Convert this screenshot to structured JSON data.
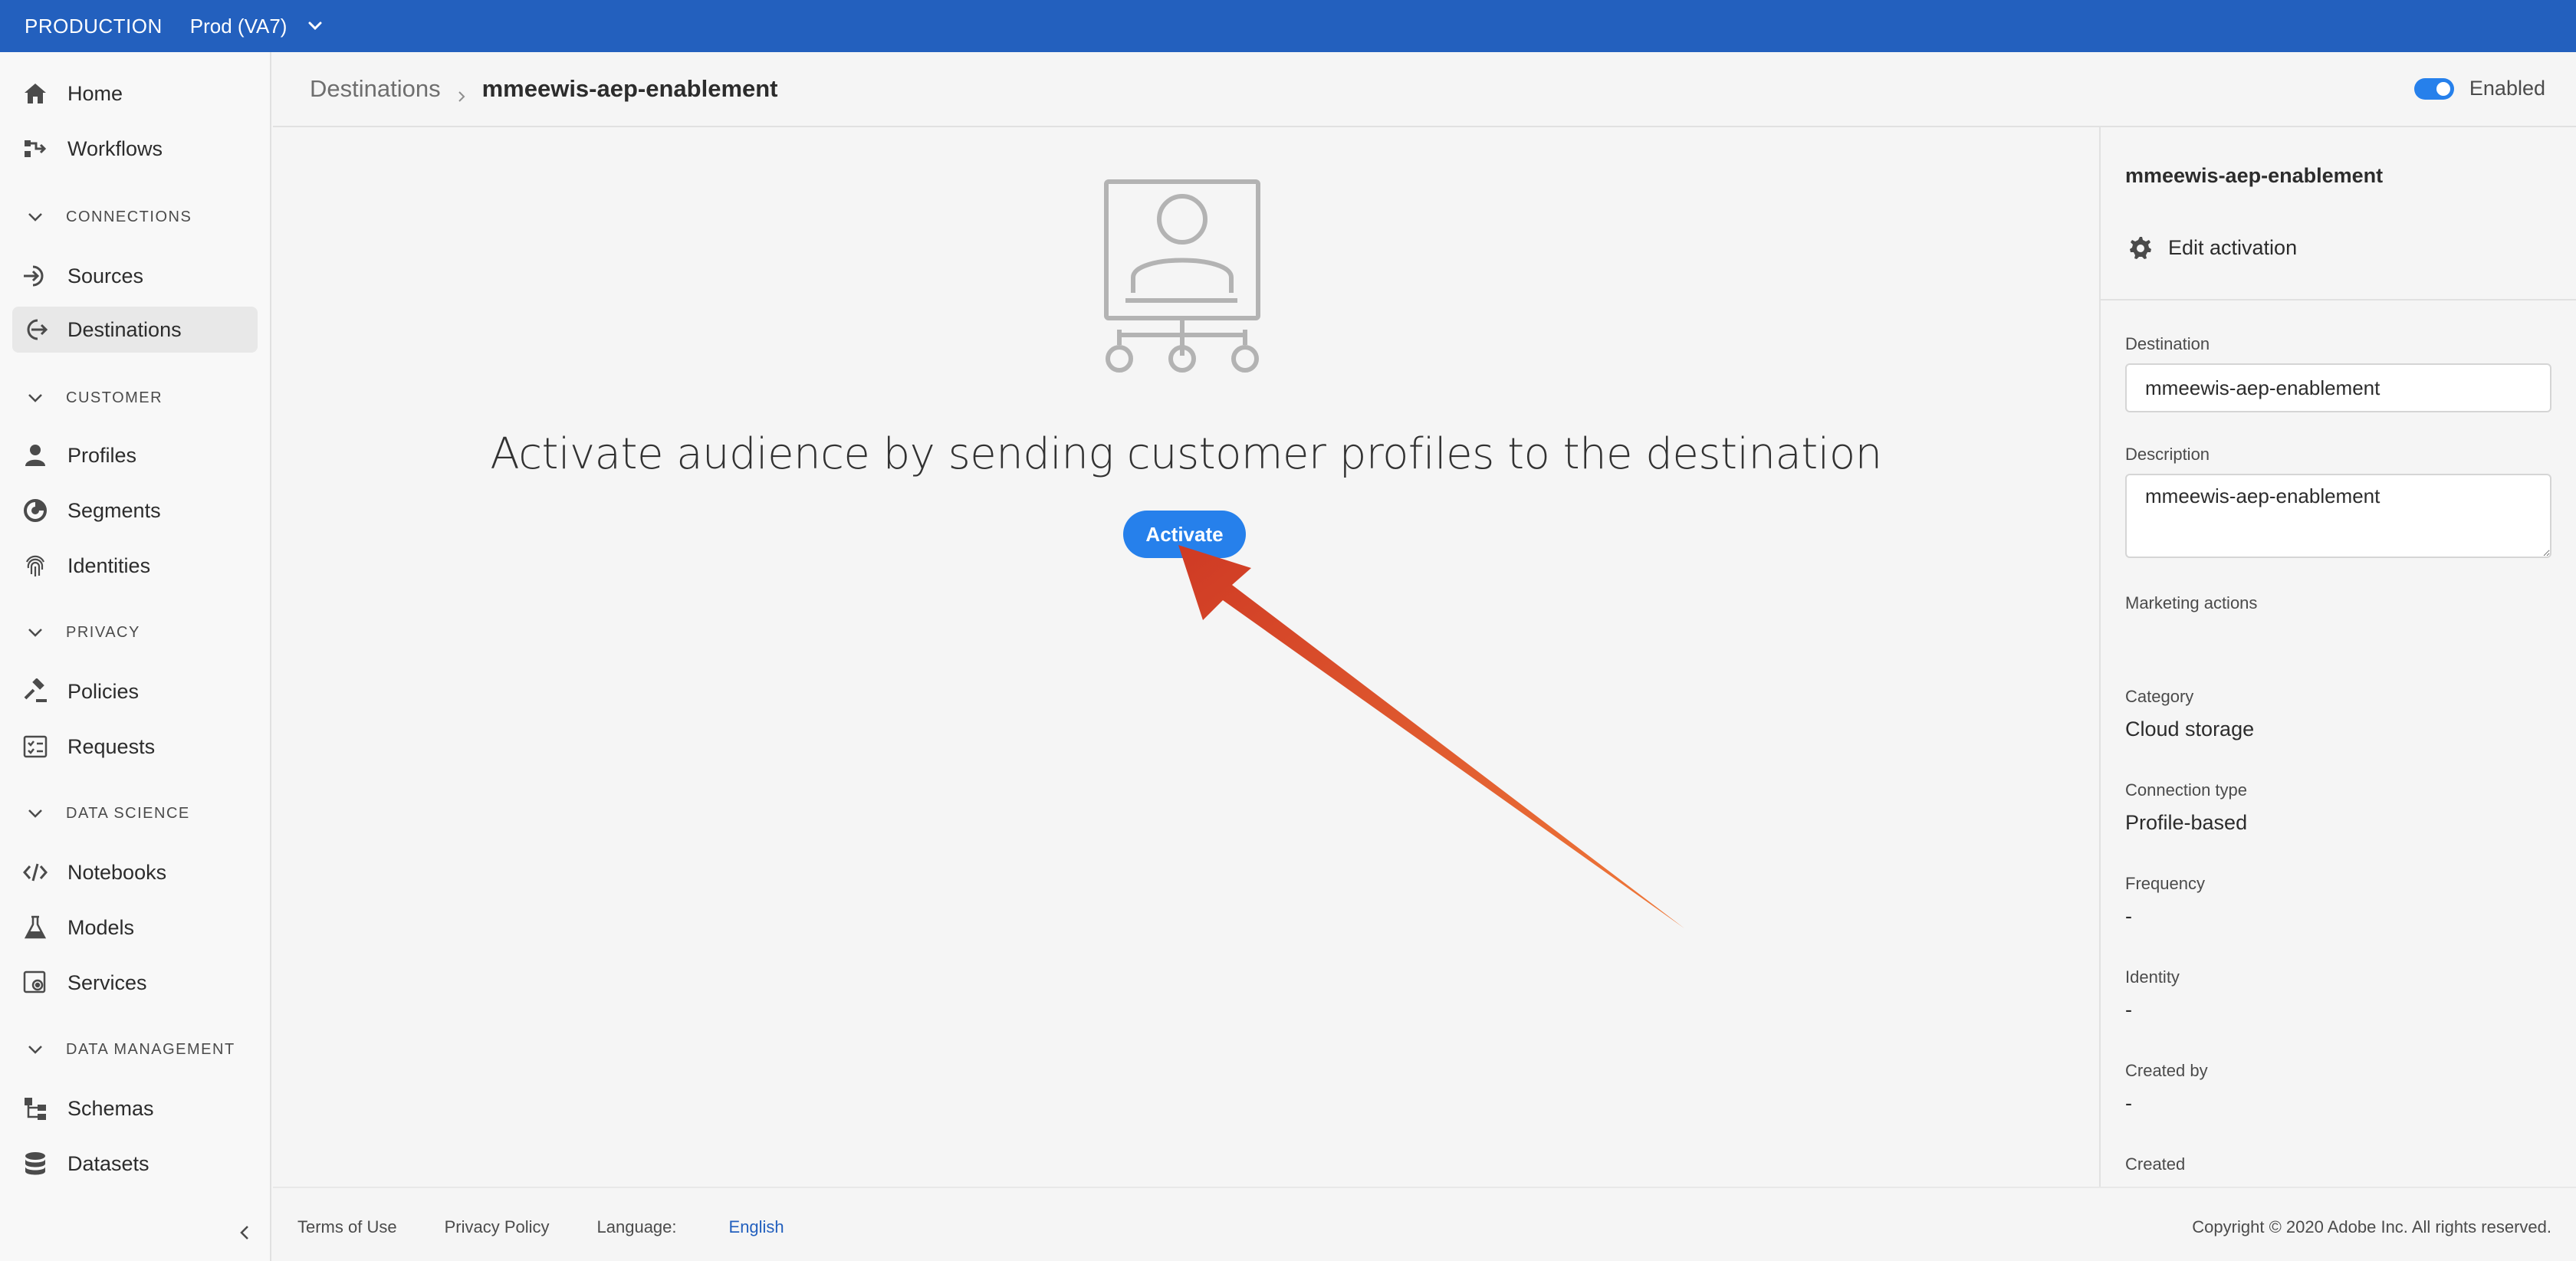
{
  "topbar": {
    "environment": "PRODUCTION",
    "sandbox": "Prod (VA7)"
  },
  "sidebar": {
    "items": [
      {
        "label": "Home",
        "icon": "home-icon"
      },
      {
        "label": "Workflows",
        "icon": "workflows-icon"
      },
      {
        "label": "Sources",
        "icon": "sources-icon"
      },
      {
        "label": "Destinations",
        "icon": "destinations-icon"
      },
      {
        "label": "Profiles",
        "icon": "profile-icon"
      },
      {
        "label": "Segments",
        "icon": "segments-icon"
      },
      {
        "label": "Identities",
        "icon": "fingerprint-icon"
      },
      {
        "label": "Policies",
        "icon": "gavel-icon"
      },
      {
        "label": "Requests",
        "icon": "checklist-icon"
      },
      {
        "label": "Notebooks",
        "icon": "code-icon"
      },
      {
        "label": "Models",
        "icon": "flask-icon"
      },
      {
        "label": "Services",
        "icon": "gear-box-icon"
      },
      {
        "label": "Schemas",
        "icon": "schema-icon"
      },
      {
        "label": "Datasets",
        "icon": "database-icon"
      }
    ],
    "sections": [
      "CONNECTIONS",
      "CUSTOMER",
      "PRIVACY",
      "DATA SCIENCE",
      "DATA MANAGEMENT"
    ],
    "active": "Destinations"
  },
  "header": {
    "breadcrumb_parent": "Destinations",
    "breadcrumb_current": "mmeewis-aep-enablement",
    "toggle_label": "Enabled",
    "toggle_on": true
  },
  "main": {
    "heading": "Activate audience by sending customer profiles to the destination",
    "activate_label": "Activate",
    "accent_color": "#2680eb",
    "arrow_color": "#e0482a"
  },
  "rail": {
    "title": "mmeewis-aep-enablement",
    "edit_label": "Edit activation",
    "destination_label": "Destination",
    "destination_value": "mmeewis-aep-enablement",
    "description_label": "Description",
    "description_value": "mmeewis-aep-enablement",
    "marketing_label": "Marketing actions",
    "category_label": "Category",
    "category_value": "Cloud storage",
    "connection_label": "Connection type",
    "connection_value": "Profile-based",
    "frequency_label": "Frequency",
    "frequency_value": "-",
    "identity_label": "Identity",
    "identity_value": "-",
    "created_by_label": "Created by",
    "created_by_value": "-",
    "created_label": "Created"
  },
  "footer": {
    "terms": "Terms of Use",
    "privacy": "Privacy Policy",
    "language_label": "Language:",
    "language_value": "English",
    "copyright": "Copyright ©  2020 Adobe Inc.  All rights reserved."
  }
}
